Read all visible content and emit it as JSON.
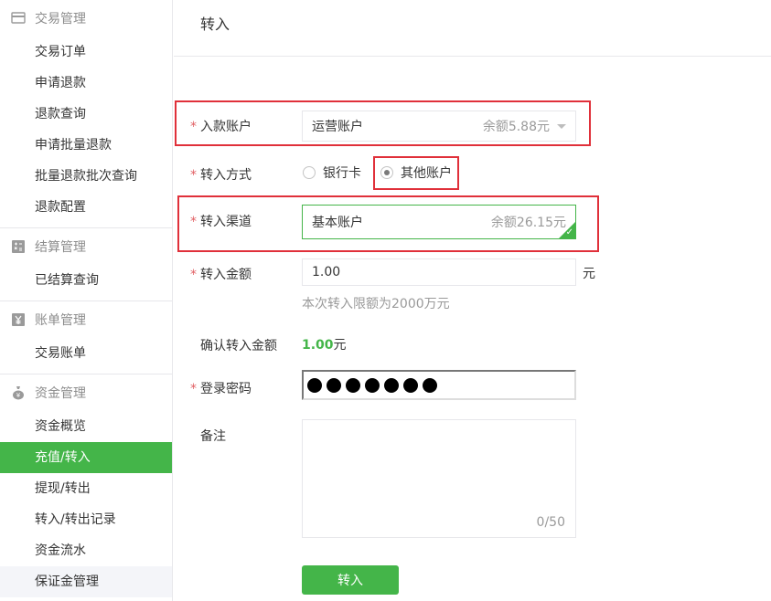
{
  "sidebar": {
    "groups": [
      {
        "title": "交易管理",
        "icon": "card-icon",
        "items": [
          "交易订单",
          "申请退款",
          "退款查询",
          "申请批量退款",
          "批量退款批次查询",
          "退款配置"
        ]
      },
      {
        "title": "结算管理",
        "icon": "calculator-icon",
        "items": [
          "已结算查询"
        ]
      },
      {
        "title": "账单管理",
        "icon": "yen-icon",
        "items": [
          "交易账单"
        ]
      },
      {
        "title": "资金管理",
        "icon": "money-bag-icon",
        "items": [
          "资金概览",
          "充值/转入",
          "提现/转出",
          "转入/转出记录",
          "资金流水",
          "保证金管理"
        ]
      }
    ],
    "active_item": "充值/转入"
  },
  "page": {
    "title": "转入"
  },
  "form": {
    "source_account": {
      "label": "入款账户",
      "value": "运营账户",
      "balance": "余额5.88元"
    },
    "method": {
      "label": "转入方式",
      "options": [
        "银行卡",
        "其他账户"
      ],
      "selected": "其他账户"
    },
    "channel": {
      "label": "转入渠道",
      "value": "基本账户",
      "balance": "余额26.15元"
    },
    "amount": {
      "label": "转入金额",
      "value": "1.00",
      "unit": "元",
      "hint": "本次转入限额为2000万元"
    },
    "confirm": {
      "label": "确认转入金额",
      "value": "1.00",
      "unit": "元"
    },
    "password": {
      "label": "登录密码",
      "masked_length": 7
    },
    "note": {
      "label": "备注",
      "counter": "0/50"
    },
    "submit_label": "转入"
  },
  "colors": {
    "accent": "#44b549",
    "required": "#e15f63",
    "highlight": "#e0303a"
  }
}
